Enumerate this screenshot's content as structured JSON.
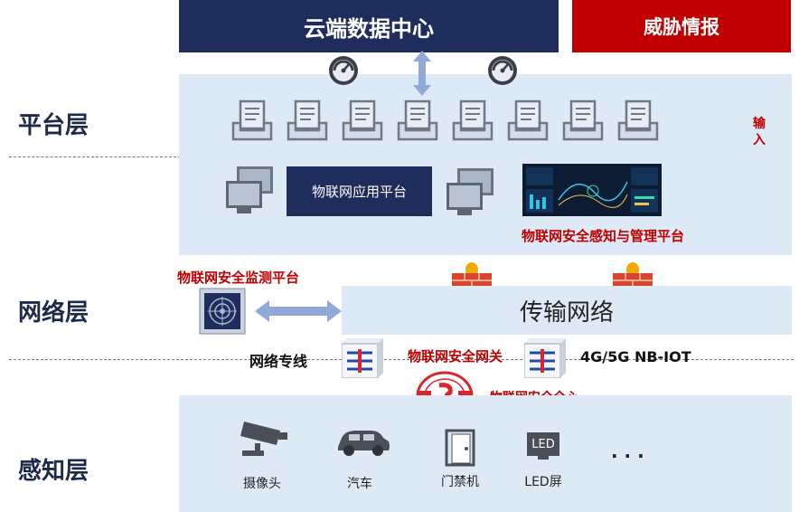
{
  "layers": {
    "platform": "平台层",
    "network": "网络层",
    "perception": "感知层"
  },
  "top": {
    "cloud_center": "云端数据中心",
    "threat_intel": "威胁情报"
  },
  "platform": {
    "iot_app_platform": "物联网应用平台",
    "iot_security_platform": "物联网安全感知与管理平台",
    "input_label": "输入"
  },
  "network": {
    "monitoring_platform": "物联网安全监测平台",
    "transport_network": "传输网络",
    "dedicated_line": "网络专线",
    "security_gateway": "物联网安全网关",
    "mobile_networks": "4G/5G NB-IOT",
    "security_core": "物联网安全全心"
  },
  "perception": {
    "devices": [
      "摄像头",
      "汽车",
      "门禁机",
      "LED屏"
    ],
    "more": "· · ·",
    "led_icon_text": "LED"
  },
  "colors": {
    "navy": "#1f2d5c",
    "red": "#c00000",
    "band": "#dde9f5"
  }
}
